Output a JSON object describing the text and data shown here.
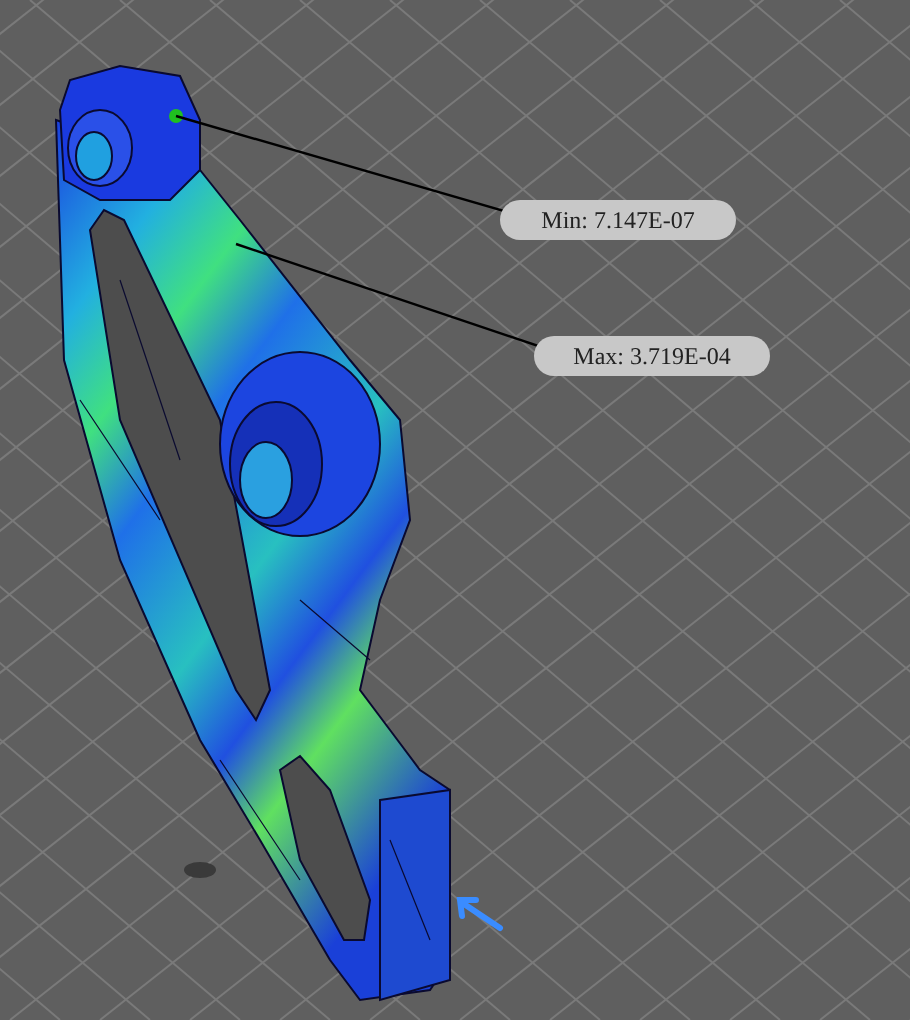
{
  "viewport": {
    "probes": [
      {
        "label": "Min: 7.147E-07"
      },
      {
        "label": "Max: 3.719E-04"
      }
    ]
  }
}
